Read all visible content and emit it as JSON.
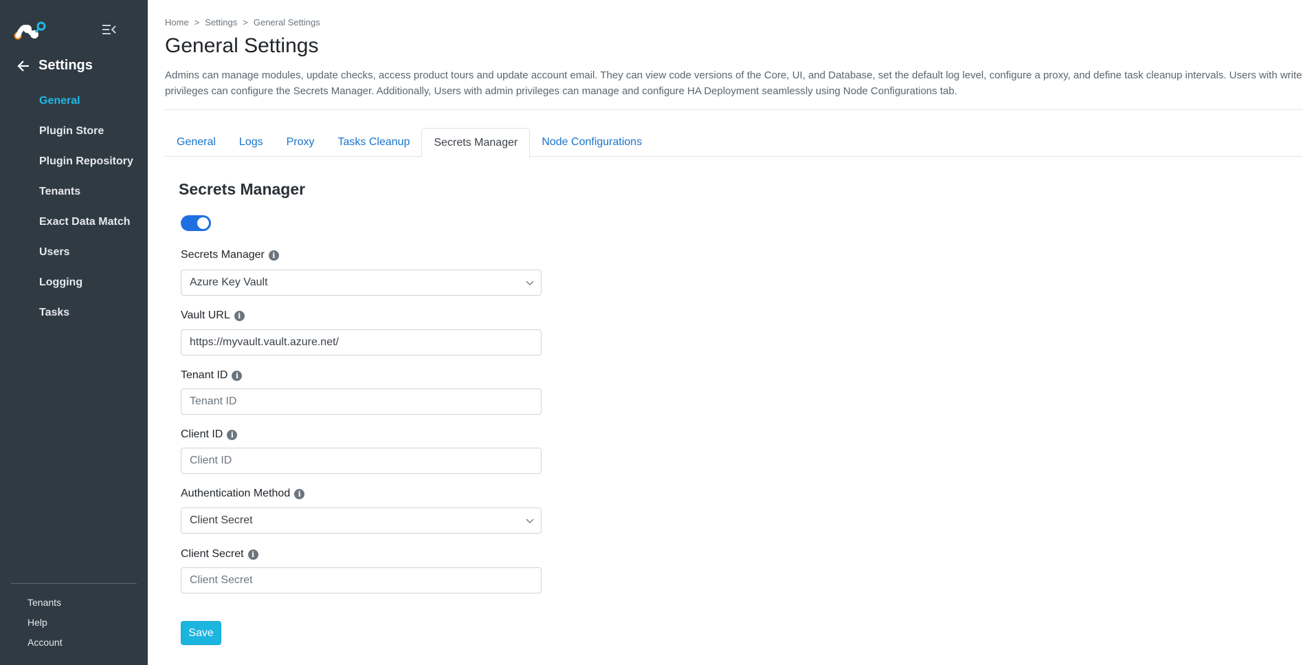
{
  "sidebar": {
    "title": "Settings",
    "items": [
      {
        "label": "General"
      },
      {
        "label": "Plugin Store"
      },
      {
        "label": "Plugin Repository"
      },
      {
        "label": "Tenants"
      },
      {
        "label": "Exact Data Match"
      },
      {
        "label": "Users"
      },
      {
        "label": "Logging"
      },
      {
        "label": "Tasks"
      }
    ],
    "active_item": "General",
    "bottom": [
      {
        "label": "Tenants"
      },
      {
        "label": "Help"
      },
      {
        "label": "Account"
      }
    ]
  },
  "breadcrumb": {
    "items": [
      "Home",
      "Settings",
      "General Settings"
    ],
    "separator": ">"
  },
  "page": {
    "title": "General Settings",
    "description": "Admins can manage modules, update checks, access product tours and update account email. They can view code versions of the Core, UI, and Database, set the default log level, configure a proxy, and define task cleanup intervals. Users with write privileges can configure the Secrets Manager. Additionally, Users with admin privileges can manage and configure HA Deployment seamlessly using Node Configurations tab."
  },
  "tabs": [
    {
      "label": "General"
    },
    {
      "label": "Logs"
    },
    {
      "label": "Proxy"
    },
    {
      "label": "Tasks Cleanup"
    },
    {
      "label": "Secrets Manager"
    },
    {
      "label": "Node Configurations"
    }
  ],
  "active_tab": "Secrets Manager",
  "form": {
    "section_title": "Secrets Manager",
    "enabled": true,
    "secrets_manager": {
      "label": "Secrets Manager",
      "value": "Azure Key Vault"
    },
    "vault_url": {
      "label": "Vault URL",
      "value": "https://myvault.vault.azure.net/",
      "placeholder": ""
    },
    "tenant_id": {
      "label": "Tenant ID",
      "value": "",
      "placeholder": "Tenant ID"
    },
    "client_id": {
      "label": "Client ID",
      "value": "",
      "placeholder": "Client ID"
    },
    "auth_method": {
      "label": "Authentication Method",
      "value": "Client Secret"
    },
    "client_secret": {
      "label": "Client Secret",
      "value": "",
      "placeholder": "Client Secret"
    },
    "save_label": "Save"
  },
  "colors": {
    "sidebar_bg": "#2f3a43",
    "accent": "#22b8e6",
    "toggle_on": "#1f6fe0",
    "link": "#1a73c9",
    "save_button": "#1cb5e0"
  },
  "icons": {
    "logo": "netskope-logo",
    "collapse": "menu-collapse-icon",
    "back": "arrow-left-icon",
    "info": "info-icon",
    "chevron": "chevron-down-icon"
  }
}
